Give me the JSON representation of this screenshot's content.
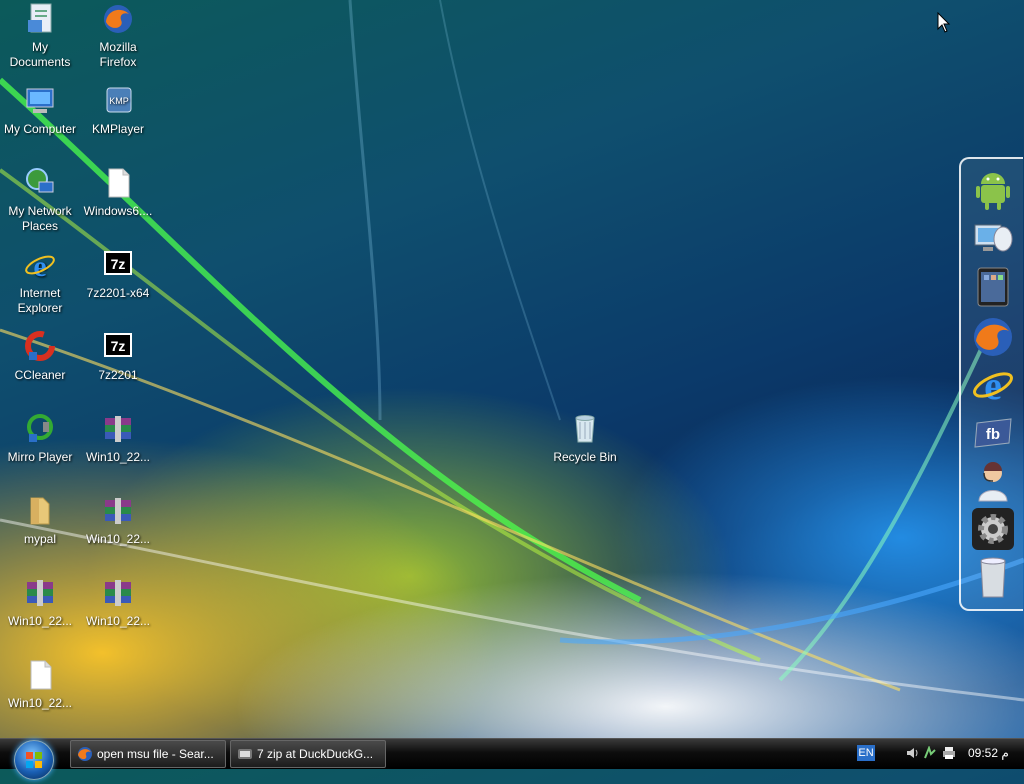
{
  "desktop_icons": [
    {
      "label": "My\nDocuments",
      "icon": "my-documents-icon"
    },
    {
      "label": "Mozilla\nFirefox",
      "icon": "firefox-icon"
    },
    {
      "label": "My Computer",
      "icon": "my-computer-icon"
    },
    {
      "label": "KMPlayer",
      "icon": "kmplayer-icon"
    },
    {
      "label": "My Network\nPlaces",
      "icon": "network-places-icon"
    },
    {
      "label": "Windows6....",
      "icon": "file-icon"
    },
    {
      "label": "Internet\nExplorer",
      "icon": "internet-explorer-icon"
    },
    {
      "label": "7z2201-x64",
      "icon": "7zip-icon"
    },
    {
      "label": "CCleaner",
      "icon": "ccleaner-icon"
    },
    {
      "label": "7z2201",
      "icon": "7zip-icon"
    },
    {
      "label": "Mirro Player",
      "icon": "media-player-icon"
    },
    {
      "label": "Win10_22...",
      "icon": "winrar-archive-icon"
    },
    {
      "label": "mypal",
      "icon": "folder-icon"
    },
    {
      "label": "Win10_22...",
      "icon": "winrar-archive-icon"
    },
    {
      "label": "Win10_22...",
      "icon": "winrar-archive-icon"
    },
    {
      "label": "Win10_22...",
      "icon": "winrar-archive-icon"
    },
    {
      "label": "Win10_22...",
      "icon": "file-icon"
    },
    {
      "label": "Recycle Bin",
      "icon": "recycle-bin-icon"
    }
  ],
  "dock_items": [
    "android-icon",
    "remote-desktop-icon",
    "tablet-icon",
    "firefox-icon",
    "internet-explorer-icon",
    "facebook-icon",
    "support-agent-icon",
    "settings-gear-icon",
    "trash-can-icon"
  ],
  "taskbar": {
    "tasks": [
      {
        "label": "open msu file - Sear...",
        "icon": "firefox-icon"
      },
      {
        "label": "7 zip at DuckDuckG...",
        "icon": "kmplayer-icon"
      }
    ],
    "language": "EN",
    "clock": "09:52 م"
  },
  "colors": {
    "taskbar": "#000000",
    "dock_border": "#ffffff",
    "wallpaper_accent": "#1e63a8"
  }
}
